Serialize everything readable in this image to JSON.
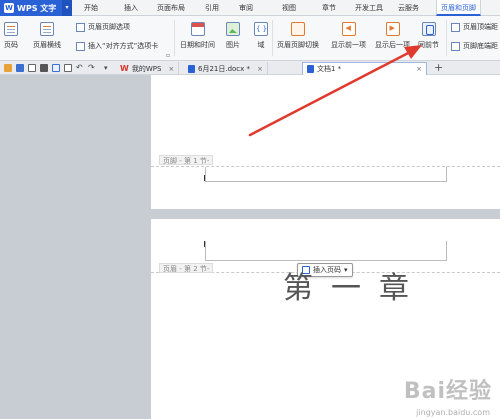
{
  "app": {
    "brand": "WPS 文字",
    "logo_glyph": "W"
  },
  "menu": {
    "items": [
      "开始",
      "插入",
      "页面布局",
      "引用",
      "审阅",
      "视图",
      "章节",
      "开发工具",
      "云服务",
      "页眉和页脚"
    ],
    "active": "页眉和页脚"
  },
  "ribbon": {
    "page_num": "页码",
    "header_line": "页眉横线",
    "header_footer_options": "页眉页脚选项",
    "insert_align_tab": "插入“对齐方式”选项卡",
    "date_time": "日期和时间",
    "picture": "图片",
    "field": "域",
    "switch_header_footer": "页眉页脚切换",
    "show_prev": "显示前一项",
    "show_next": "显示后一项",
    "same_as_prev": "同前节",
    "header_top_distance": "页眉顶端距",
    "footer_bottom_distance": "页脚底端距",
    "dropdown_glyph": "▾"
  },
  "tabs": {
    "items": [
      {
        "label": "我的WPS",
        "icon": "wps-w-icon"
      },
      {
        "label": "6月21日.docx *",
        "icon": "doc-icon"
      },
      {
        "label": "文档1 *",
        "icon": "doc-icon",
        "active": true
      }
    ],
    "close_glyph": "×",
    "new_tab_glyph": "+"
  },
  "document": {
    "page1_footer_label": "页脚 - 第 1 节-",
    "page2_header_label": "页眉 - 第 2 节-",
    "insert_page_num": "插入页码",
    "chapter_text": "第一章"
  },
  "watermark": {
    "text": "Bai经验",
    "sub": "jingyan.baidu.com"
  },
  "colors": {
    "accent": "#2a62d6",
    "arrow": "#e03a2f"
  }
}
